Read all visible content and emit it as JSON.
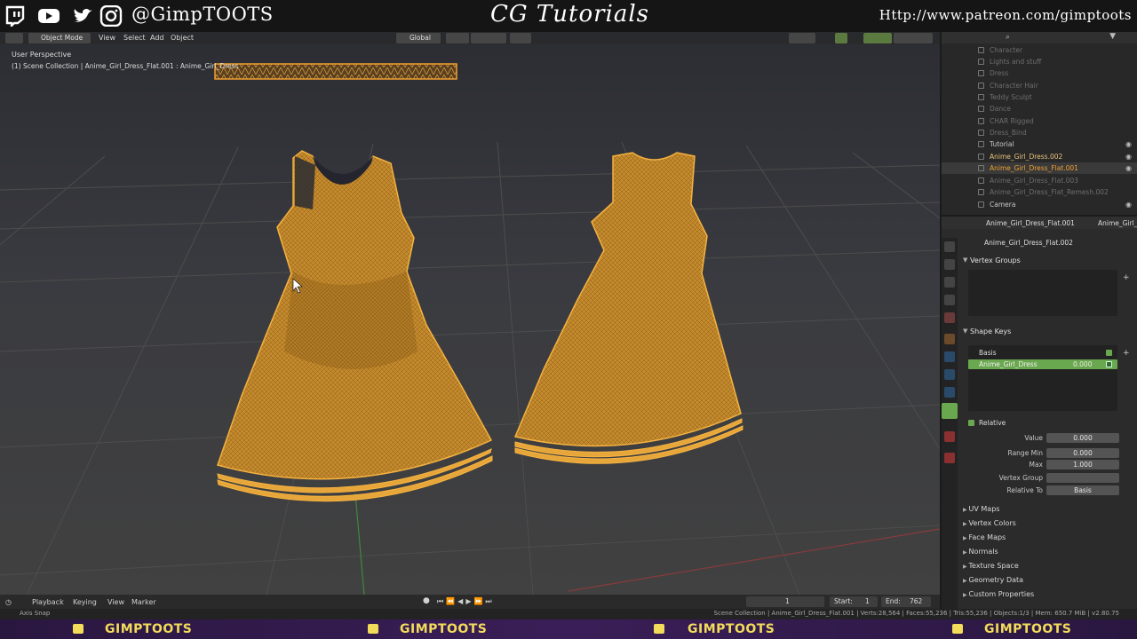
{
  "banner": {
    "handle": "@GimpTOOTS",
    "title": "CG Tutorials",
    "url": "Http://www.patreon.com/gimptoots",
    "icons": [
      "twitch-icon",
      "youtube-icon",
      "twitter-icon",
      "instagram-icon"
    ]
  },
  "viewport_header": {
    "mode": "Object Mode",
    "menus": [
      "View",
      "Select",
      "Add",
      "Object"
    ],
    "transform": "Global"
  },
  "viewport": {
    "perspective": "User Perspective",
    "collection_path": "(1) Scene Collection | Anime_Girl_Dress_Flat.001 : Anime_Girl_Dress"
  },
  "outliner": {
    "rows": [
      {
        "label": "Character",
        "dim": true
      },
      {
        "label": "Lights and stuff",
        "dim": true
      },
      {
        "label": "Dress",
        "dim": true
      },
      {
        "label": "Character Hair",
        "dim": true
      },
      {
        "label": "Teddy Sculpt",
        "dim": true
      },
      {
        "label": "Dance",
        "dim": true
      },
      {
        "label": "CHAR Rigged",
        "dim": true
      },
      {
        "label": "Dress_Bind",
        "dim": true
      },
      {
        "label": "Tutorial",
        "dim": false
      },
      {
        "label": "Anime_Girl_Dress.002",
        "dim": false,
        "color": "#e8c27a"
      },
      {
        "label": "Anime_Girl_Dress_Flat.001",
        "dim": false,
        "color": "#f0a030"
      },
      {
        "label": "Anime_Girl_Dress_Flat.003",
        "dim": true
      },
      {
        "label": "Anime_Girl_Dress_Flat_Remesh.002",
        "dim": true
      },
      {
        "label": "Camera",
        "dim": false
      }
    ]
  },
  "properties": {
    "object_name": "Anime_Girl_Dress_Flat.001",
    "object_name_2": "Anime_Girl_",
    "mesh_name": "Anime_Girl_Dress_Flat.002",
    "vertex_groups_title": "Vertex Groups",
    "shape_keys_title": "Shape Keys",
    "shape_keys": [
      {
        "name": "Basis",
        "value": ""
      },
      {
        "name": "Anime_Girl_Dress",
        "value": "0.000"
      }
    ],
    "relative_label": "Relative",
    "fields": [
      {
        "label": "Value",
        "value": "0.000"
      },
      {
        "label": "Range Min",
        "value": "0.000"
      },
      {
        "label": "Max",
        "value": "1.000"
      },
      {
        "label": "Vertex Group",
        "value": ""
      },
      {
        "label": "Relative To",
        "value": "Basis"
      }
    ],
    "sections": [
      "UV Maps",
      "Vertex Colors",
      "Face Maps",
      "Normals",
      "Texture Space",
      "Geometry Data",
      "Custom Properties"
    ]
  },
  "timeline": {
    "menus": [
      "Playback",
      "Keying",
      "View",
      "Marker"
    ],
    "current_frame": "1",
    "start_label": "Start:",
    "start": "1",
    "end_label": "End:",
    "end": "762"
  },
  "status": {
    "left": "Axis Snap",
    "right": "Scene Collection | Anime_Girl_Dress_Flat.001 | Verts:28,564 | Faces:55,236 | Tris:55,236 | Objects:1/3 | Mem: 650.7 MiB | v2.80.75"
  },
  "footer": {
    "labels": [
      "GIMPTOOTS",
      "GIMPTOOTS",
      "GIMPTOOTS",
      "GIMPTOOTS"
    ]
  },
  "colors": {
    "accent_orange": "#f0a030",
    "dress_fill": "#c8902c",
    "footer_text": "#f2dc5a",
    "shape_key_active": "#6aa84f"
  }
}
